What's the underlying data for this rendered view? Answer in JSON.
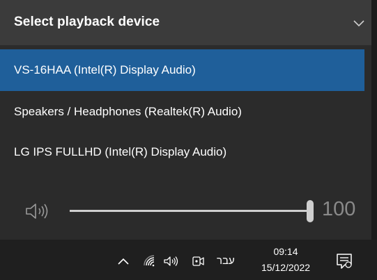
{
  "header": {
    "title": "Select playback device",
    "chevron_icon": "chevron-down-icon"
  },
  "devices": [
    {
      "label": "VS-16HAA (Intel(R) Display Audio)",
      "selected": true
    },
    {
      "label": "Speakers / Headphones (Realtek(R) Audio)",
      "selected": false
    },
    {
      "label": "LG IPS FULLHD (Intel(R) Display Audio)",
      "selected": false
    }
  ],
  "volume": {
    "icon": "speaker-icon",
    "level": 100,
    "value_label": "100"
  },
  "taskbar": {
    "tray_icons": [
      "chevron-up-icon",
      "wifi-icon",
      "speaker-icon",
      "meet-now-icon"
    ],
    "language": "עבר",
    "time": "09:14",
    "date": "15/12/2022",
    "notification_icon": "notification-icon"
  },
  "colors": {
    "selected_bg": "#1f5f9a",
    "flyout_bg": "#2b2b2b",
    "header_bg": "#3b3b3b",
    "taskbar_bg": "#1f1f1f"
  }
}
